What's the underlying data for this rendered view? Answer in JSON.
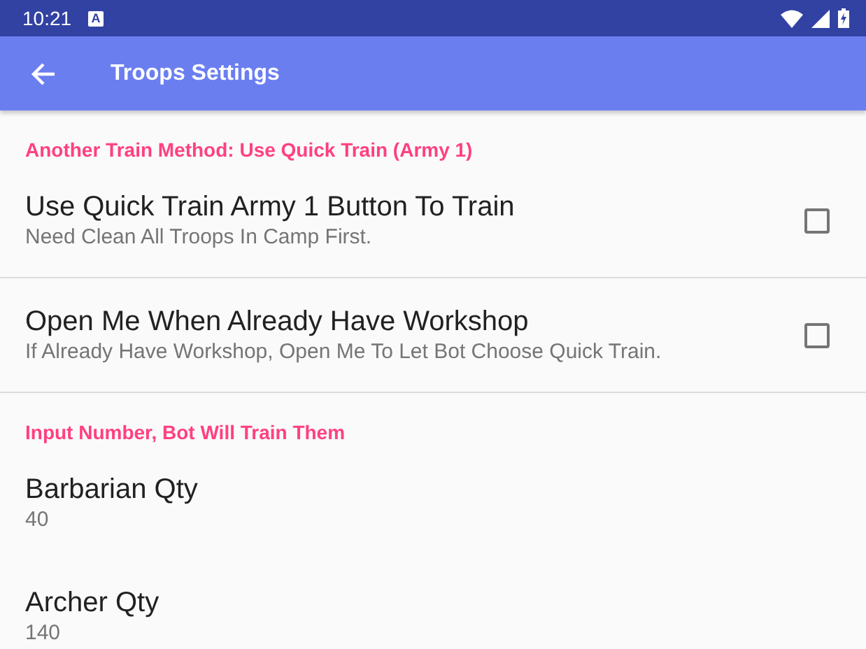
{
  "status_bar": {
    "time": "10:21",
    "notification": "A"
  },
  "app_bar": {
    "title": "Troops Settings"
  },
  "sections": [
    {
      "title": "Another Train Method: Use Quick Train (Army 1)",
      "items": [
        {
          "kind": "checkbox",
          "title": "Use Quick Train Army 1 Button To Train",
          "summary": "Need Clean All Troops In Camp First.",
          "checked": false
        },
        {
          "kind": "checkbox",
          "title": "Open Me When Already Have Workshop",
          "summary": "If Already Have Workshop, Open Me To Let Bot Choose Quick Train.",
          "checked": false
        }
      ]
    },
    {
      "title": "Input Number, Bot Will Train Them",
      "items": [
        {
          "kind": "text",
          "title": "Barbarian Qty",
          "summary": "40"
        },
        {
          "kind": "text",
          "title": "Archer Qty",
          "summary": "140"
        }
      ]
    }
  ]
}
